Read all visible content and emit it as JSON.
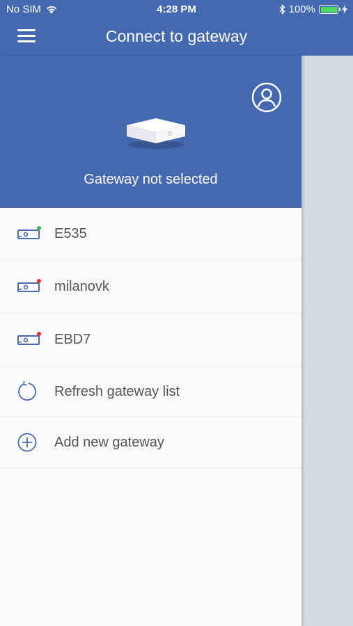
{
  "status_bar": {
    "carrier": "No SIM",
    "time": "4:28 PM",
    "battery": "100%",
    "battery_color": "#4cd964",
    "icons": [
      "wifi-icon",
      "bluetooth-icon",
      "battery-icon",
      "charging-icon"
    ]
  },
  "nav": {
    "title": "Connect to gateway",
    "menu_icon": "hamburger-menu-icon"
  },
  "hero": {
    "profile_icon": "user-profile-icon",
    "device_icon": "gateway-device-icon",
    "status_text": "Gateway not selected"
  },
  "gateways": [
    {
      "name": "E535",
      "status": "online",
      "status_color": "#3cba54"
    },
    {
      "name": "milanovk",
      "status": "offline",
      "status_color": "#e8312f"
    },
    {
      "name": "EBD7",
      "status": "offline",
      "status_color": "#e8312f"
    }
  ],
  "actions": {
    "refresh_label": "Refresh gateway list",
    "add_label": "Add new gateway"
  },
  "colors": {
    "primary": "#4469b0",
    "icon_blue": "#4a6aae",
    "backdrop": "#d5dbe3"
  }
}
